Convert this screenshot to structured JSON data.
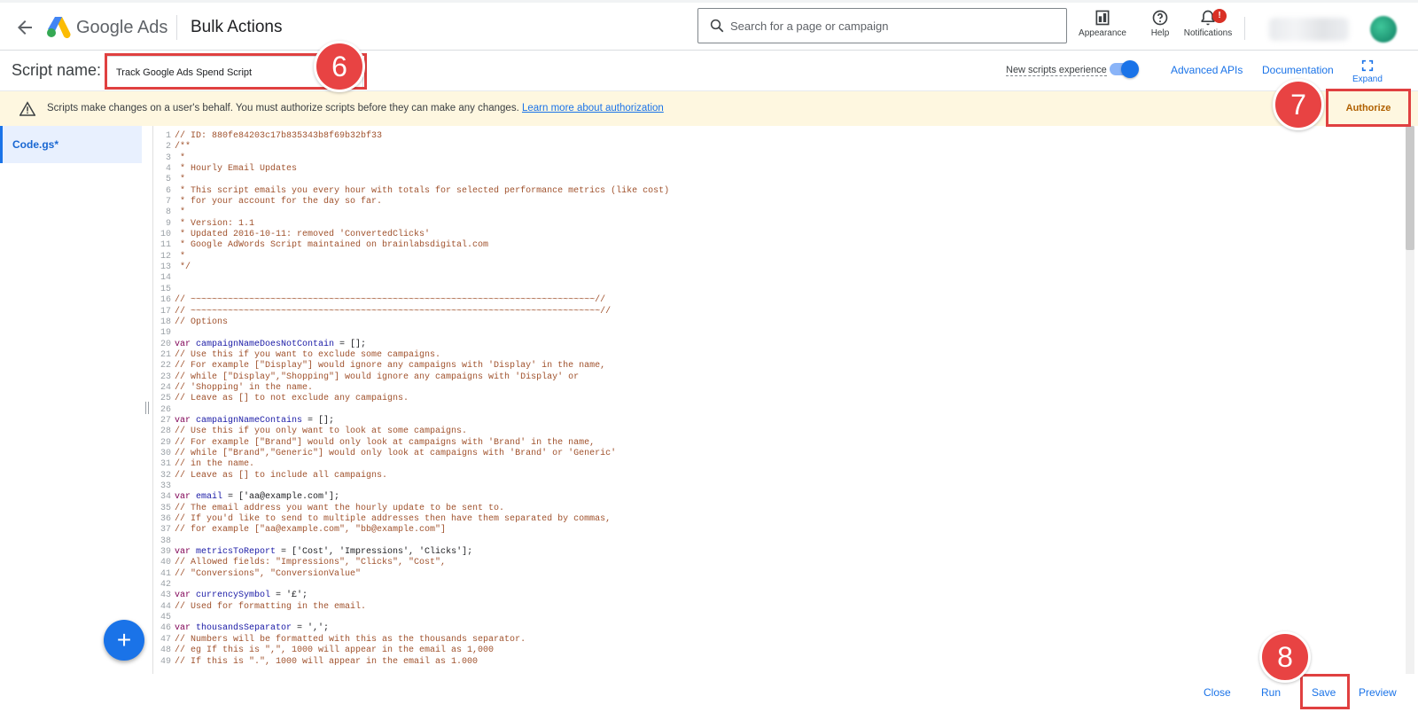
{
  "header": {
    "brand": "Google Ads",
    "page_title": "Bulk Actions",
    "search_placeholder": "Search for a page or campaign",
    "appearance_label": "Appearance",
    "help_label": "Help",
    "notifications_label": "Notifications",
    "notifications_badge": "!"
  },
  "script": {
    "name_label": "Script name:",
    "name_value": "Track Google Ads Spend Script",
    "new_experience_label": "New scripts experience",
    "new_experience_on": true,
    "advanced_apis": "Advanced APIs",
    "documentation": "Documentation",
    "expand": "Expand"
  },
  "banner": {
    "text": "Scripts make changes on a user's behalf. You must authorize scripts before they can make any changes.",
    "link": "Learn more about authorization",
    "authorize": "Authorize"
  },
  "files": [
    {
      "name": "Code.gs*"
    }
  ],
  "callouts": {
    "six": "6",
    "seven": "7",
    "eight": "8"
  },
  "code_lines": [
    {
      "n": "1",
      "t": "// ID: 880fe84203c17b835343b8f69b32bf33",
      "c": "com"
    },
    {
      "n": "2",
      "t": "/**",
      "c": "com"
    },
    {
      "n": "3",
      "t": " *",
      "c": "com"
    },
    {
      "n": "4",
      "t": " * Hourly Email Updates",
      "c": "com"
    },
    {
      "n": "5",
      "t": " *",
      "c": "com"
    },
    {
      "n": "6",
      "t": " * This script emails you every hour with totals for selected performance metrics (like cost)",
      "c": "com"
    },
    {
      "n": "7",
      "t": " * for your account for the day so far.",
      "c": "com"
    },
    {
      "n": "8",
      "t": " *",
      "c": "com"
    },
    {
      "n": "9",
      "t": " * Version: 1.1",
      "c": "com"
    },
    {
      "n": "10",
      "t": " * Updated 2016-10-11: removed 'ConvertedClicks'",
      "c": "com"
    },
    {
      "n": "11",
      "t": " * Google AdWords Script maintained on brainlabsdigital.com",
      "c": "com"
    },
    {
      "n": "12",
      "t": " *",
      "c": "com"
    },
    {
      "n": "13",
      "t": " */",
      "c": "com"
    },
    {
      "n": "14",
      "t": "",
      "c": "pl"
    },
    {
      "n": "15",
      "t": "",
      "c": "pl"
    },
    {
      "n": "16",
      "t": "// ~~~~~~~~~~~~~~~~~~~~~~~~~~~~~~~~~~~~~~~~~~~~~~~~~~~~~~~~~~~~~~~~~~~~~~~~~~~~//",
      "c": "com"
    },
    {
      "n": "17",
      "t": "// ~~~~~~~~~~~~~~~~~~~~~~~~~~~~~~~~~~~~~~~~~~~~~~~~~~~~~~~~~~~~~~~~~~~~~~~~~~~~~//",
      "c": "com"
    },
    {
      "n": "18",
      "t": "// Options",
      "c": "com"
    },
    {
      "n": "19",
      "t": "",
      "c": "pl"
    },
    {
      "n": "20",
      "kw": "var ",
      "v": "campaignNameDoesNotContain",
      "rest": " = [];",
      "c": "decl"
    },
    {
      "n": "21",
      "t": "// Use this if you want to exclude some campaigns.",
      "c": "com"
    },
    {
      "n": "22",
      "t": "// For example [\"Display\"] would ignore any campaigns with 'Display' in the name,",
      "c": "com"
    },
    {
      "n": "23",
      "t": "// while [\"Display\",\"Shopping\"] would ignore any campaigns with 'Display' or",
      "c": "com"
    },
    {
      "n": "24",
      "t": "// 'Shopping' in the name.",
      "c": "com"
    },
    {
      "n": "25",
      "t": "// Leave as [] to not exclude any campaigns.",
      "c": "com"
    },
    {
      "n": "26",
      "t": "",
      "c": "pl"
    },
    {
      "n": "27",
      "kw": "var ",
      "v": "campaignNameContains",
      "rest": " = [];",
      "c": "decl"
    },
    {
      "n": "28",
      "t": "// Use this if you only want to look at some campaigns.",
      "c": "com"
    },
    {
      "n": "29",
      "t": "// For example [\"Brand\"] would only look at campaigns with 'Brand' in the name,",
      "c": "com"
    },
    {
      "n": "30",
      "t": "// while [\"Brand\",\"Generic\"] would only look at campaigns with 'Brand' or 'Generic'",
      "c": "com"
    },
    {
      "n": "31",
      "t": "// in the name.",
      "c": "com"
    },
    {
      "n": "32",
      "t": "// Leave as [] to include all campaigns.",
      "c": "com"
    },
    {
      "n": "33",
      "t": "",
      "c": "pl"
    },
    {
      "n": "34",
      "kw": "var ",
      "v": "email",
      "rest": " = ['aa@example.com'];",
      "c": "decl"
    },
    {
      "n": "35",
      "t": "// The email address you want the hourly update to be sent to.",
      "c": "com"
    },
    {
      "n": "36",
      "t": "// If you'd like to send to multiple addresses then have them separated by commas,",
      "c": "com"
    },
    {
      "n": "37",
      "t": "// for example [\"aa@example.com\", \"bb@example.com\"]",
      "c": "com"
    },
    {
      "n": "38",
      "t": "",
      "c": "pl"
    },
    {
      "n": "39",
      "kw": "var ",
      "v": "metricsToReport",
      "rest": " = ['Cost', 'Impressions', 'Clicks'];",
      "c": "decl"
    },
    {
      "n": "40",
      "t": "// Allowed fields: \"Impressions\", \"Clicks\", \"Cost\",",
      "c": "com"
    },
    {
      "n": "41",
      "t": "// \"Conversions\", \"ConversionValue\"",
      "c": "com"
    },
    {
      "n": "42",
      "t": "",
      "c": "pl"
    },
    {
      "n": "43",
      "kw": "var ",
      "v": "currencySymbol",
      "rest": " = '£';",
      "c": "decl"
    },
    {
      "n": "44",
      "t": "// Used for formatting in the email.",
      "c": "com"
    },
    {
      "n": "45",
      "t": "",
      "c": "pl"
    },
    {
      "n": "46",
      "kw": "var ",
      "v": "thousandsSeparator",
      "rest": " = ',';",
      "c": "decl"
    },
    {
      "n": "47",
      "t": "// Numbers will be formatted with this as the thousands separator.",
      "c": "com"
    },
    {
      "n": "48",
      "t": "// eg If this is \",\", 1000 will appear in the email as 1,000",
      "c": "com"
    },
    {
      "n": "49",
      "t": "// If this is \".\", 1000 will appear in the email as 1.000",
      "c": "com"
    }
  ],
  "footer": {
    "close": "Close",
    "run": "Run",
    "save": "Save",
    "preview": "Preview"
  },
  "colors": {
    "accent": "#1a73e8",
    "callout": "#e84343",
    "banner": "#fef7e0"
  },
  "icons": {
    "back": "arrow-left-icon",
    "search": "search-icon",
    "appearance": "appearance-icon",
    "help": "help-circle-icon",
    "notifications": "bell-icon",
    "expand": "fullscreen-icon",
    "warning": "warning-triangle-icon",
    "add": "plus-icon"
  }
}
